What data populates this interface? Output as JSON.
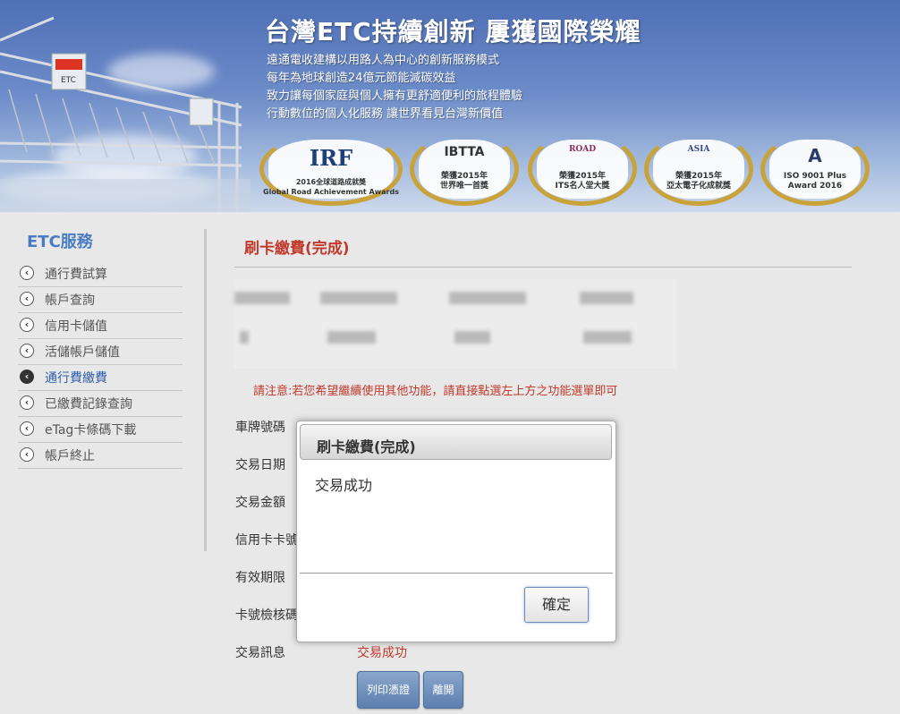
{
  "banner": {
    "title": "台灣ETC持續創新  屢獲國際榮耀",
    "lines": [
      "遠通電收建構以用路人為中心的創新服務模式",
      "每年為地球創造24億元節能減碳效益",
      "致力讓每個家庭與個人擁有更舒適便利的旅程體驗",
      "行動數位的個人化服務  讓世界看見台灣新價值"
    ],
    "awards": [
      {
        "logo": "IRF",
        "text": "2016全球道路成就獎\nGlobal Road Achievement Awards"
      },
      {
        "logo": "IBTTA",
        "text": "榮獲2015年\n世界唯一首獎"
      },
      {
        "logo": "ROAD",
        "text": "榮獲2015年\nITS名人堂大獎"
      },
      {
        "logo": "ASIA",
        "text": "榮獲2015年\n亞太電子化成就獎"
      },
      {
        "logo": "A",
        "text": "ISO 9001 Plus\nAward 2016"
      }
    ],
    "gantry_sign": "ETC"
  },
  "sidebar": {
    "title": "ETC服務",
    "items": [
      {
        "label": "通行費試算",
        "active": false
      },
      {
        "label": "帳戶查詢",
        "active": false
      },
      {
        "label": "信用卡儲值",
        "active": false
      },
      {
        "label": "活儲帳戶儲值",
        "active": false
      },
      {
        "label": "通行費繳費",
        "active": true
      },
      {
        "label": "已繳費記錄查詢",
        "active": false
      },
      {
        "label": "eTag卡條碼下載",
        "active": false
      },
      {
        "label": "帳戶終止",
        "active": false
      }
    ]
  },
  "main": {
    "title": "刷卡繳費(完成)",
    "notice": "請注意:若您希望繼續使用其他功能，請直接點選左上方之功能選單即可",
    "fields": [
      {
        "label": "車牌號碼",
        "value": ""
      },
      {
        "label": "交易日期",
        "value": ""
      },
      {
        "label": "交易金額",
        "value": ""
      },
      {
        "label": "信用卡卡號",
        "value": ""
      },
      {
        "label": "有效期限",
        "value": ""
      },
      {
        "label": "卡號檢核碼",
        "value": ""
      },
      {
        "label": "交易訊息",
        "value": "交易成功"
      }
    ],
    "print_button": "列印憑證",
    "leave_button": "離開"
  },
  "modal": {
    "title": "刷卡繳費(完成)",
    "message": "交易成功",
    "ok_button": "確定"
  },
  "colors": {
    "accent_red": "#c0392b",
    "sidebar_blue": "#4a7cc1",
    "button_blue": "#5c7fae"
  }
}
